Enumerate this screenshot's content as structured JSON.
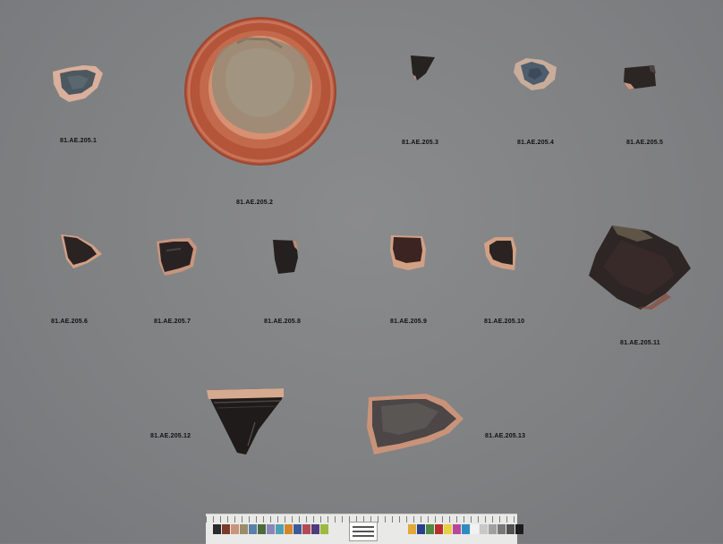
{
  "labels": {
    "l1": "81.AE.205.1",
    "l2": "81.AE.205.2",
    "l3": "81.AE.205.3",
    "l4": "81.AE.205.4",
    "l5": "81.AE.205.5",
    "l6": "81.AE.205.6",
    "l7": "81.AE.205.7",
    "l8": "81.AE.205.8",
    "l9": "81.AE.205.9",
    "l10": "81.AE.205.10",
    "l11": "81.AE.205.11",
    "l12": "81.AE.205.12",
    "l13": "81.AE.205.13"
  },
  "colors": {
    "background": "#808183",
    "terracotta": "#b8573a",
    "black_glaze": "#2a2424",
    "clay_pink": "#d9a58a"
  },
  "color_chart": [
    "#2b2b2b",
    "#7a3b2a",
    "#c8957a",
    "#9a8c6a",
    "#5a7fa8",
    "#4c6b3a",
    "#8b86b8",
    "#4fa0b3",
    "#d3862c",
    "#3b5a9a",
    "#b34a53",
    "#523b7a",
    "#9cb941",
    "#e2a93a",
    "#2a3f8c",
    "#4d8a3e",
    "#b8302e",
    "#e5d043",
    "#b8479a",
    "#2f8cc0",
    "#f2f2f2",
    "#c8c8c8",
    "#a0a0a0",
    "#787878",
    "#505050",
    "#1c1c1c"
  ]
}
